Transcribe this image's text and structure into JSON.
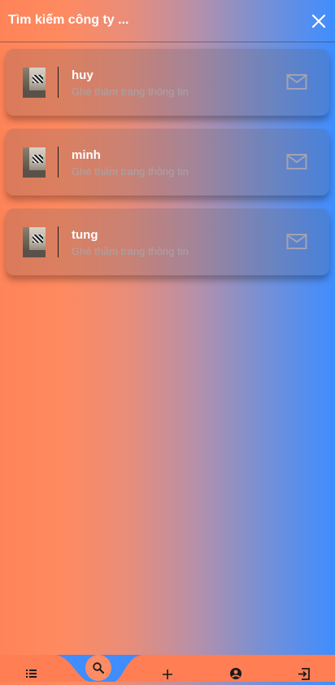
{
  "app_bar": {
    "title": "Tìm kiếm công ty ...",
    "close_icon": "close-icon"
  },
  "companies": [
    {
      "name": "huy",
      "subtitle": "Ghé thăm trang thông tin"
    },
    {
      "name": "minh",
      "subtitle": "Ghé thăm trang thông tin"
    },
    {
      "name": "tung",
      "subtitle": "Ghé thăm trang thông tin"
    }
  ],
  "bottom_nav": {
    "items": [
      "list-icon",
      "search-icon",
      "add-icon",
      "account-icon",
      "logout-icon"
    ],
    "active": "search-icon"
  },
  "colors": {
    "gradient_left": "#ff8358",
    "gradient_right": "#3f8dff",
    "nav_bar": "#ff7e54",
    "nav_accent": "#3f8dff",
    "fab": "#ff8c64"
  }
}
